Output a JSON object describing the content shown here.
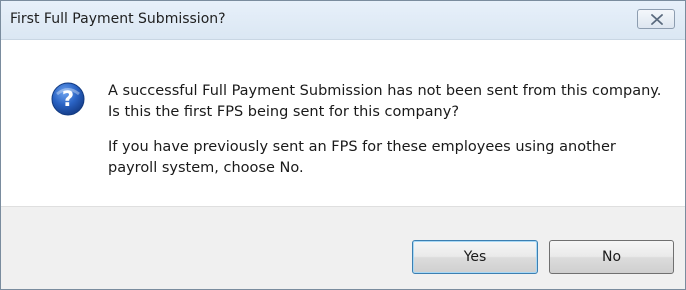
{
  "window": {
    "title": "First Full Payment Submission?",
    "close_icon": "close-icon"
  },
  "dialog": {
    "icon": "question-icon",
    "message_line1": "A successful Full Payment Submission has not been sent from this company. Is this the first FPS being sent for this company?",
    "message_line2": "If you have previously sent an FPS for these employees using another payroll system, choose No."
  },
  "buttons": {
    "yes_label": "Yes",
    "no_label": "No"
  },
  "colors": {
    "titlebar": "#dbe7f3",
    "footer": "#f0f0f0",
    "icon_blue": "#2a63c4",
    "default_button_border": "#3c7fb1"
  }
}
